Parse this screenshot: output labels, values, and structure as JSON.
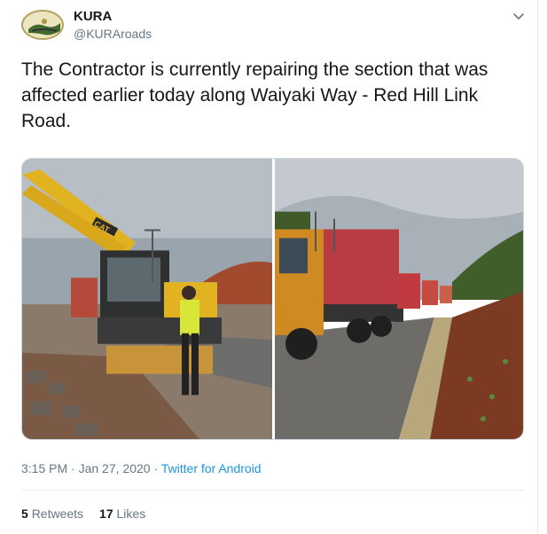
{
  "user": {
    "name": "KURA",
    "handle": "@KURAroads"
  },
  "tweet": {
    "text": "The Contractor is currently repairing the section that was affected earlier today along Waiyaki Way - Red Hill Link Road.",
    "time": "3:15 PM",
    "date": "Jan 27, 2020",
    "source": "Twitter for Android",
    "separator": " · "
  },
  "stats": {
    "retweets_count": "5",
    "retweets_label": "Retweets",
    "likes_count": "17",
    "likes_label": "Likes"
  },
  "photo_left": {
    "excavator_text": "CAT"
  },
  "icons": {
    "avatar": "kura-logo-icon",
    "menu": "chevron-down-icon"
  },
  "colors": {
    "link": "#1b95e0",
    "muted": "#657786",
    "text": "#14171a"
  }
}
